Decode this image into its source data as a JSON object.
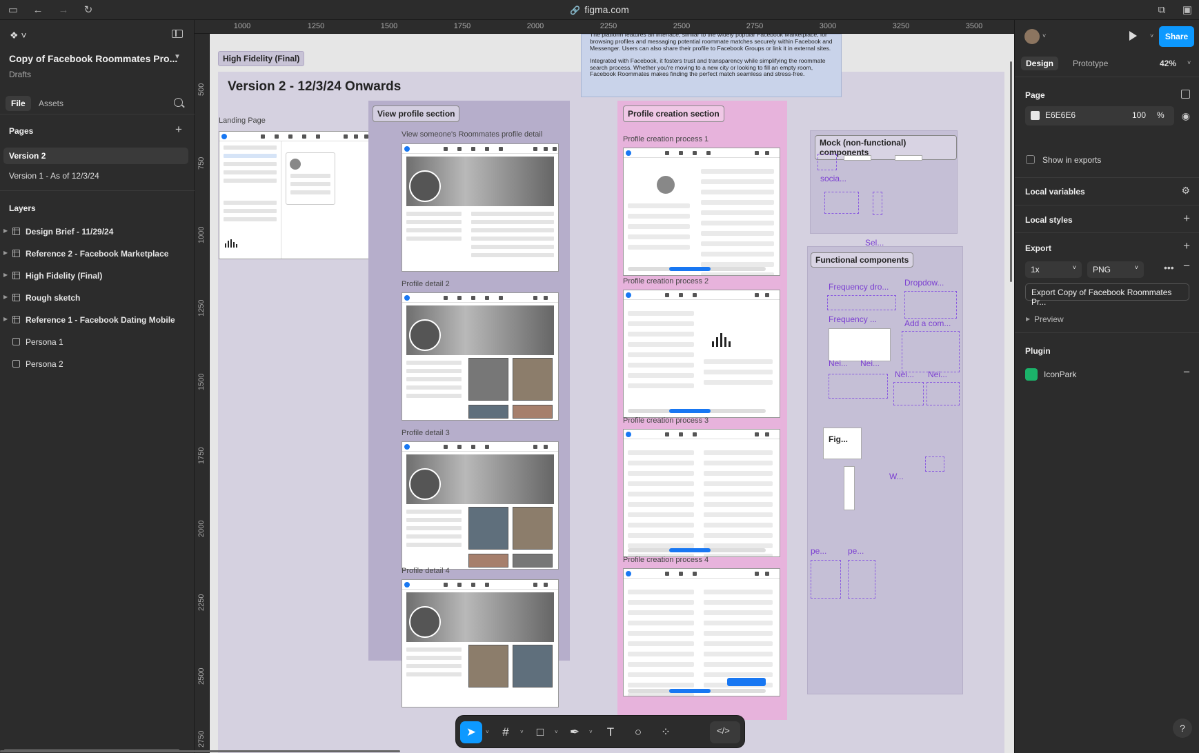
{
  "browser": {
    "url": "figma.com"
  },
  "left_panel": {
    "file_title": "Copy of Facebook Roommates Pro...",
    "file_subtitle": "Drafts",
    "tabs": [
      "File",
      "Assets"
    ],
    "pages_heading": "Pages",
    "pages": [
      "Version 2",
      "Version 1 - As of 12/3/24"
    ],
    "selected_page": "Version 2",
    "layers_heading": "Layers",
    "layers": [
      {
        "label": "Design Brief - 11/29/24",
        "type": "frame"
      },
      {
        "label": "Reference 2 - Facebook Marketplace",
        "type": "frame"
      },
      {
        "label": "High Fidelity (Final)",
        "type": "frame"
      },
      {
        "label": "Rough sketch",
        "type": "frame"
      },
      {
        "label": "Reference 1 - Facebook Dating Mobile",
        "type": "frame"
      },
      {
        "label": "Persona 1",
        "type": "image"
      },
      {
        "label": "Persona 2",
        "type": "image"
      }
    ]
  },
  "rulers": {
    "top": [
      "1000",
      "1250",
      "1500",
      "1750",
      "2000",
      "2250",
      "2500",
      "2750",
      "3000",
      "3250",
      "3500"
    ],
    "left": [
      "500",
      "750",
      "1000",
      "1250",
      "1500",
      "1750",
      "2000",
      "2250",
      "2500",
      "2750"
    ]
  },
  "canvas": {
    "frame_name": "High Fidelity (Final)",
    "big_title": "Version 2 - 12/3/24 Onwards",
    "landing_label": "Landing Page",
    "view_section_label": "View profile section",
    "view_screens": [
      "View someone's Roommates profile detail",
      "Profile detail 2",
      "Profile detail 3",
      "Profile detail 4"
    ],
    "creation_section_label": "Profile creation section",
    "creation_screens": [
      "Profile creation process 1",
      "Profile creation process 2",
      "Profile creation process 3",
      "Profile creation process 4"
    ],
    "mock_label": "Mock (non-functional) components",
    "functional_label": "Functional components",
    "component_tags": [
      "socia...",
      "Sel...",
      "Frequency dro...",
      "Dropdow...",
      "Frequency ...",
      "Add a com...",
      "Nei...",
      "Nei...",
      "Nei...",
      "Nei...",
      "Fig...",
      "W...",
      "pe...",
      "pe..."
    ],
    "info_text_1": "The platform features an interface, similar to the widely popular Facebook Marketplace, for browsing profiles and messaging potential roommate matches securely within Facebook and Messenger. Users can also share their profile to Facebook Groups or link it in external sites.",
    "info_text_2": "Integrated with Facebook, it fosters trust and transparency while simplifying the roommate search process. Whether you're moving to a new city or looking to fill an empty room, Facebook Roommates makes finding the perfect match seamless and stress-free."
  },
  "right_panel": {
    "share_label": "Share",
    "tabs": [
      "Design",
      "Prototype"
    ],
    "zoom": "42%",
    "page_heading": "Page",
    "page_color": "E6E6E6",
    "page_opacity": "100",
    "percent": "%",
    "show_in_exports": "Show in exports",
    "local_variables": "Local variables",
    "local_styles": "Local styles",
    "export_heading": "Export",
    "export_scale": "1x",
    "export_format": "PNG",
    "export_button": "Export Copy of Facebook Roommates Pr...",
    "preview_label": "Preview",
    "plugin_heading": "Plugin",
    "plugin_name": "IconPark",
    "help": "?"
  },
  "colors": {
    "accent": "#0d99ff",
    "canvas_bg": "#e6e6e6",
    "facebook_blue": "#1877f2",
    "component_purple": "#7b3fd1"
  }
}
